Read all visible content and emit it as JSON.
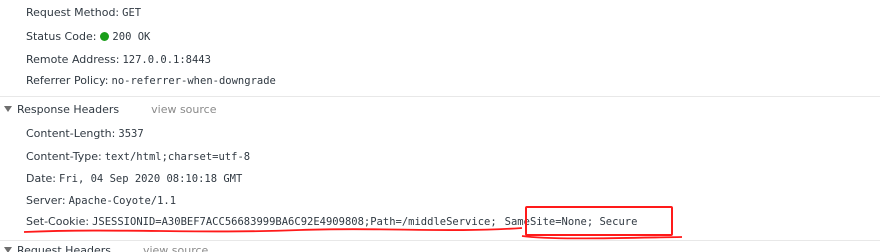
{
  "general": {
    "request_method": {
      "name": "Request Method:",
      "value": "GET"
    },
    "status_code": {
      "name": "Status Code:",
      "value": "200 OK"
    },
    "remote_address": {
      "name": "Remote Address:",
      "value": "127.0.0.1:8443"
    },
    "referrer_policy": {
      "name": "Referrer Policy:",
      "value": "no-referrer-when-downgrade"
    }
  },
  "response_headers": {
    "title": "Response Headers",
    "view_source": "view source",
    "rows": [
      {
        "name": "Content-Length:",
        "value": "3537"
      },
      {
        "name": "Content-Type:",
        "value": "text/html;charset=utf-8"
      },
      {
        "name": "Date:",
        "value": "Fri, 04 Sep 2020 08:10:18 GMT"
      },
      {
        "name": "Server:",
        "value": "Apache-Coyote/1.1"
      },
      {
        "name": "Set-Cookie:",
        "value": "JSESSIONID=A30BEF7ACC56683999BA6C92E4909808;Path=/middleService;",
        "value_highlight": "SameSite=None; Secure"
      }
    ]
  },
  "request_headers": {
    "title": "Request Headers",
    "view_source": "view source"
  },
  "colors": {
    "status_ok": "#1a9e1a",
    "annotation_red": "#ff1a1a"
  }
}
